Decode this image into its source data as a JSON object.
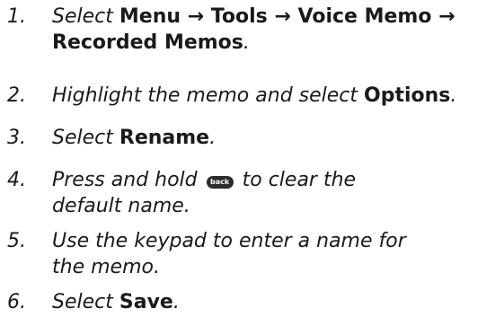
{
  "steps": [
    {
      "number": "1.",
      "line1": {
        "prefix": "Select ",
        "menu": "Menu",
        "arrow1": " → ",
        "tools": "Tools",
        "arrow2": " → ",
        "voice_memo": "Voice Memo",
        "arrow3": " →"
      },
      "line2": {
        "recorded_memos": "Recorded Memos",
        "end": "."
      }
    },
    {
      "number": "2.",
      "prefix": "Highlight the memo and select ",
      "options": "Options",
      "end": "."
    },
    {
      "number": "3.",
      "prefix": "Select ",
      "rename": "Rename",
      "end": "."
    },
    {
      "number": "4.",
      "prefix": "Press and hold ",
      "key_label": "back",
      "suffix": " to clear the",
      "line2": "default name."
    },
    {
      "number": "5.",
      "line1": "Use the keypad to enter a name for",
      "line2": "the memo."
    },
    {
      "number": "6.",
      "prefix": "Select ",
      "save": "Save",
      "end": "."
    }
  ]
}
